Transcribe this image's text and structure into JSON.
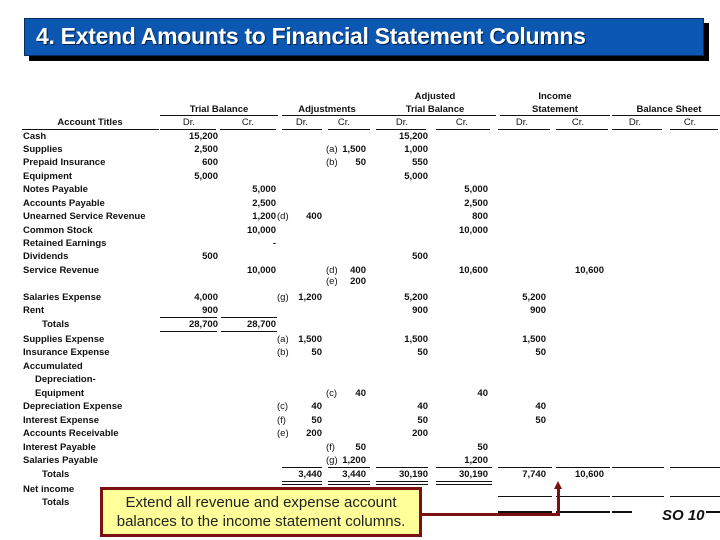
{
  "title": "4. Extend Amounts to Financial Statement Columns",
  "headers": {
    "account_titles": "Account Titles",
    "trial_balance": "Trial Balance",
    "adjustments": "Adjustments",
    "adjusted_tb_line1": "Adjusted",
    "adjusted_tb_line2": "Trial Balance",
    "income_line1": "Income",
    "income_line2": "Statement",
    "balance_sheet": "Balance Sheet",
    "dr": "Dr.",
    "cr": "Cr."
  },
  "rows": [
    {
      "account": "Cash",
      "tb_dr": "15,200",
      "atb_dr": "15,200"
    },
    {
      "account": "Supplies",
      "tb_dr": "2,500",
      "adj_cr_ref": "(a)",
      "adj_cr": "1,500",
      "atb_dr": "1,000"
    },
    {
      "account": "Prepaid Insurance",
      "tb_dr": "600",
      "adj_cr_ref": "(b)",
      "adj_cr": "50",
      "atb_dr": "550"
    },
    {
      "account": "Equipment",
      "tb_dr": "5,000",
      "atb_dr": "5,000"
    },
    {
      "account": "Notes Payable",
      "tb_cr": "5,000",
      "atb_cr": "5,000"
    },
    {
      "account": "Accounts Payable",
      "tb_cr": "2,500",
      "atb_cr": "2,500"
    },
    {
      "account": "Unearned Service Revenue",
      "tb_cr": "1,200",
      "adj_dr_ref": "(d)",
      "adj_dr": "400",
      "atb_cr": "800"
    },
    {
      "account": "Common Stock",
      "tb_cr": "10,000",
      "atb_cr": "10,000"
    },
    {
      "account": "Retained Earnings",
      "tb_cr": "-"
    },
    {
      "account": "Dividends",
      "tb_dr": "500",
      "atb_dr": "500"
    },
    {
      "account": "Service Revenue",
      "tb_cr": "10,000",
      "adj_cr_ref": "(d)",
      "adj_cr": "400",
      "adj_cr2_ref": "(e)",
      "adj_cr2": "200",
      "atb_cr": "10,600",
      "is_cr": "10,600"
    },
    {
      "account": "Salaries Expense",
      "tb_dr": "4,000",
      "adj_dr_ref": "(g)",
      "adj_dr": "1,200",
      "atb_dr": "5,200",
      "is_dr": "5,200"
    },
    {
      "account": "Rent",
      "tb_dr": "900",
      "atb_dr": "900",
      "is_dr": "900"
    },
    {
      "account": "Totals",
      "tb_dr": "28,700",
      "tb_cr": "28,700"
    },
    {
      "account": "Supplies Expense",
      "adj_dr_ref": "(a)",
      "adj_dr": "1,500",
      "atb_dr": "1,500",
      "is_dr": "1,500"
    },
    {
      "account": "Insurance Expense",
      "adj_dr_ref": "(b)",
      "adj_dr": "50",
      "atb_dr": "50",
      "is_dr": "50"
    },
    {
      "account": "Accumulated"
    },
    {
      "account": "Depreciation-"
    },
    {
      "account": "Equipment",
      "adj_cr_ref": "(c)",
      "adj_cr": "40",
      "atb_cr": "40"
    },
    {
      "account": "Depreciation Expense",
      "adj_dr_ref": "(c)",
      "adj_dr": "40",
      "atb_dr": "40",
      "is_dr": "40"
    },
    {
      "account": "Interest Expense",
      "adj_dr_ref": "(f)",
      "adj_dr": "50",
      "atb_dr": "50",
      "is_dr": "50"
    },
    {
      "account": "Accounts Receivable",
      "adj_dr_ref": "(e)",
      "adj_dr": "200",
      "atb_dr": "200"
    },
    {
      "account": "Interest Payable",
      "adj_cr_ref": "(f)",
      "adj_cr": "50",
      "atb_cr": "50"
    },
    {
      "account": "Salaries Payable",
      "adj_cr_ref": "(g)",
      "adj_cr": "1,200",
      "atb_cr": "1,200"
    },
    {
      "account": "Totals",
      "adj_dr": "3,440",
      "adj_cr": "3,440",
      "atb_dr": "30,190",
      "atb_cr": "30,190",
      "is_dr": "7,740",
      "is_cr": "10,600"
    },
    {
      "account": "Net income"
    },
    {
      "account": "Totals"
    }
  ],
  "callout": {
    "line1": "Extend all revenue and expense account",
    "line2": "balances to the income statement columns."
  },
  "footer": {
    "so_label": "SO 10"
  },
  "colors": {
    "title_bg": "#0b57b1",
    "callout_bg": "#ffff99",
    "callout_border": "#7a1010"
  }
}
